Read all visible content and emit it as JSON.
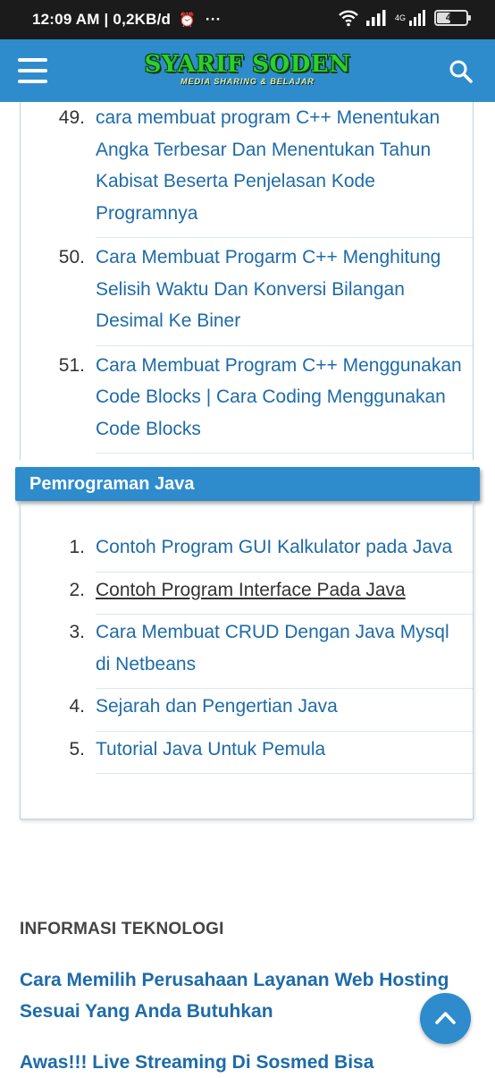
{
  "status_bar": {
    "time_speed": "12:09 AM | 0,2KB/d",
    "alarm_glyph": "⏰",
    "more_glyph": "···",
    "network_label": "4G",
    "battery_level": "46",
    "battery_fraction": 0.46
  },
  "header": {
    "logo_title": "SYARIF SODEN",
    "logo_subtitle": "MEDIA SHARING & BELAJAR",
    "menu_icon": "hamburger-menu-icon",
    "search_icon": "search-icon",
    "bg_color": "#2e8ccc"
  },
  "cpp_list": [
    {
      "num": "49.",
      "text": "cara membuat program C++ Menentukan Angka Terbesar Dan Menentukan Tahun Kabisat Beserta Penjelasan Kode Programnya"
    },
    {
      "num": "50.",
      "text": "Cara Membuat Progarm C++ Menghitung Selisih Waktu Dan Konversi Bilangan Desimal Ke Biner"
    },
    {
      "num": "51.",
      "text": "Cara Membuat Program C++ Menggunakan Code Blocks | Cara Coding Menggunakan Code Blocks"
    }
  ],
  "java_section": {
    "title": "Pemrograman Java",
    "items": [
      {
        "num": "1.",
        "text": "Contoh Program GUI Kalkulator pada Java"
      },
      {
        "num": "2.",
        "text": "Contoh Program Interface Pada Java"
      },
      {
        "num": "3.",
        "text": "Cara Membuat CRUD Dengan Java Mysql di Netbeans"
      },
      {
        "num": "4.",
        "text": "Sejarah dan Pengertian Java"
      },
      {
        "num": "5.",
        "text": "Tutorial Java Untuk Pemula"
      }
    ]
  },
  "info_section": {
    "title": "INFORMASI TEKNOLOGI",
    "articles": [
      "Cara Memilih Perusahaan Layanan Web Hosting Sesuai Yang Anda Butuhkan",
      "Awas!!! Live Streaming Di Sosmed Bisa"
    ]
  },
  "back_to_top_icon": "chevron-up-icon",
  "colors": {
    "link": "#1e6ba8",
    "accent": "#2e8ccc",
    "status_bar": "#1b1b1b"
  }
}
